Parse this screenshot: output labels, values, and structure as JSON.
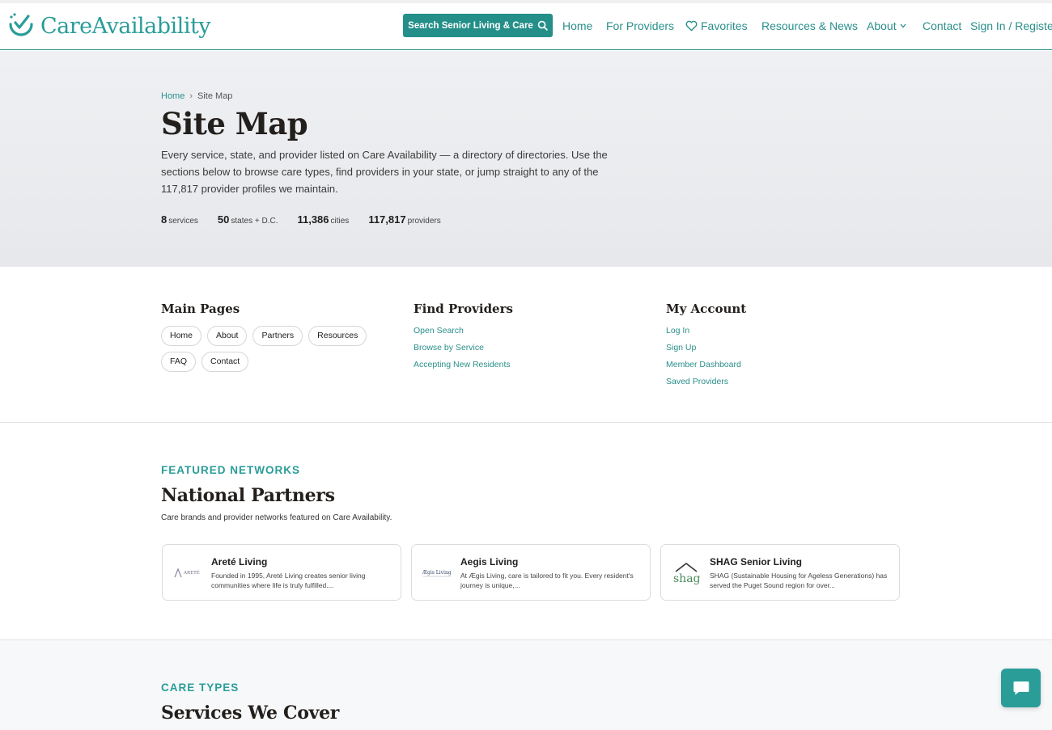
{
  "brand": {
    "name": "CareAvailability",
    "color": "#2a9d98"
  },
  "header": {
    "search_button": "Search Senior Living & Care",
    "nav": {
      "home": "Home",
      "providers": "For Providers",
      "favorites": "Favorites",
      "resources": "Resources & News",
      "about": "About",
      "contact": "Contact",
      "signin": "Sign In / Register"
    }
  },
  "breadcrumb": {
    "home": "Home",
    "sep": "›",
    "current": "Site Map"
  },
  "hero": {
    "title": "Site Map",
    "description": "Every service, state, and provider listed on Care Availability — a directory of directories. Use the sections below to browse care types, find providers in your state, or jump straight to any of the 117,817 provider profiles we maintain.",
    "stats": [
      {
        "value": "8",
        "label": "services"
      },
      {
        "value": "50",
        "label": "states + D.C."
      },
      {
        "value": "11,386",
        "label": "cities"
      },
      {
        "value": "117,817",
        "label": "providers"
      }
    ]
  },
  "main_pages": {
    "title": "Main Pages",
    "items": [
      "Home",
      "About",
      "Partners",
      "Resources",
      "FAQ",
      "Contact"
    ]
  },
  "find_providers": {
    "title": "Find Providers",
    "items": [
      "Open Search",
      "Browse by Service",
      "Accepting New Residents"
    ]
  },
  "my_account": {
    "title": "My Account",
    "items": [
      "Log In",
      "Sign Up",
      "Member Dashboard",
      "Saved Providers"
    ]
  },
  "partners": {
    "eyebrow": "FEATURED NETWORKS",
    "title": "National Partners",
    "subtitle": "Care brands and provider networks featured on Care Availability.",
    "cards": [
      {
        "name": "Areté Living",
        "logo_text": "ARETÉ",
        "desc": "Founded in 1995, Areté Living creates senior living communities where life is truly fulfilled...."
      },
      {
        "name": "Aegis Living",
        "logo_text": "Ægis Living",
        "desc": "At Ægis Living, care is tailored to fit you. Every resident's journey is unique,..."
      },
      {
        "name": "SHAG Senior Living",
        "logo_text": "shag",
        "desc": "SHAG (Sustainable Housing for Ageless Generations) has served the Puget Sound region for over..."
      }
    ]
  },
  "care_types": {
    "eyebrow": "CARE TYPES",
    "title": "Services We Cover"
  }
}
